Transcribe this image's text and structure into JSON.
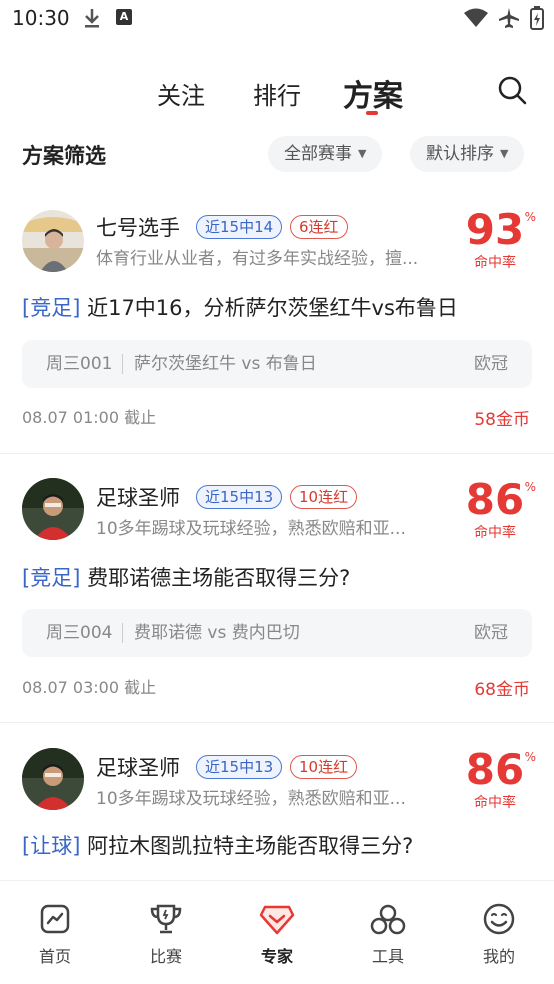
{
  "status_bar": {
    "time": "10:30"
  },
  "top_tabs": [
    {
      "label": "关注",
      "active": false
    },
    {
      "label": "排行",
      "active": false
    },
    {
      "label": "方案",
      "active": true
    }
  ],
  "filter": {
    "title": "方案筛选",
    "competition": "全部赛事",
    "sort": "默认排序"
  },
  "plans": [
    {
      "expert_name": "七号选手",
      "record_badge": "近15中14",
      "streak_badge": "6连红",
      "description": "体育行业从业者，有过多年实战经验，擅...",
      "hit_rate": "93",
      "hit_rate_unit": "%",
      "hit_rate_label": "命中率",
      "tag": "[竞足]",
      "title": "近17中16，分析萨尔茨堡红牛vs布鲁日",
      "match_code": "周三001",
      "match_teams": "萨尔茨堡红牛 vs 布鲁日",
      "league": "欧冠",
      "deadline": "08.07 01:00 截止",
      "price": "58金币"
    },
    {
      "expert_name": "足球圣师",
      "record_badge": "近15中13",
      "streak_badge": "10连红",
      "description": "10多年踢球及玩球经验，熟悉欧赔和亚...",
      "hit_rate": "86",
      "hit_rate_unit": "%",
      "hit_rate_label": "命中率",
      "tag": "[竞足]",
      "title": "费耶诺德主场能否取得三分?",
      "match_code": "周三004",
      "match_teams": "费耶诺德 vs 费内巴切",
      "league": "欧冠",
      "deadline": "08.07 03:00 截止",
      "price": "68金币"
    },
    {
      "expert_name": "足球圣师",
      "record_badge": "近15中13",
      "streak_badge": "10连红",
      "description": "10多年踢球及玩球经验，熟悉欧赔和亚...",
      "hit_rate": "86",
      "hit_rate_unit": "%",
      "hit_rate_label": "命中率",
      "tag": "[让球]",
      "title": "阿拉木图凯拉特主场能否取得三分?"
    }
  ],
  "bottom_nav": [
    {
      "label": "首页",
      "icon": "home-chart-icon"
    },
    {
      "label": "比赛",
      "icon": "trophy-icon"
    },
    {
      "label": "专家",
      "icon": "expert-gem-icon",
      "active": true
    },
    {
      "label": "工具",
      "icon": "tools-circles-icon"
    },
    {
      "label": "我的",
      "icon": "smiley-icon"
    }
  ],
  "colors": {
    "accent": "#e53935",
    "tag_blue": "#3a66c8"
  }
}
